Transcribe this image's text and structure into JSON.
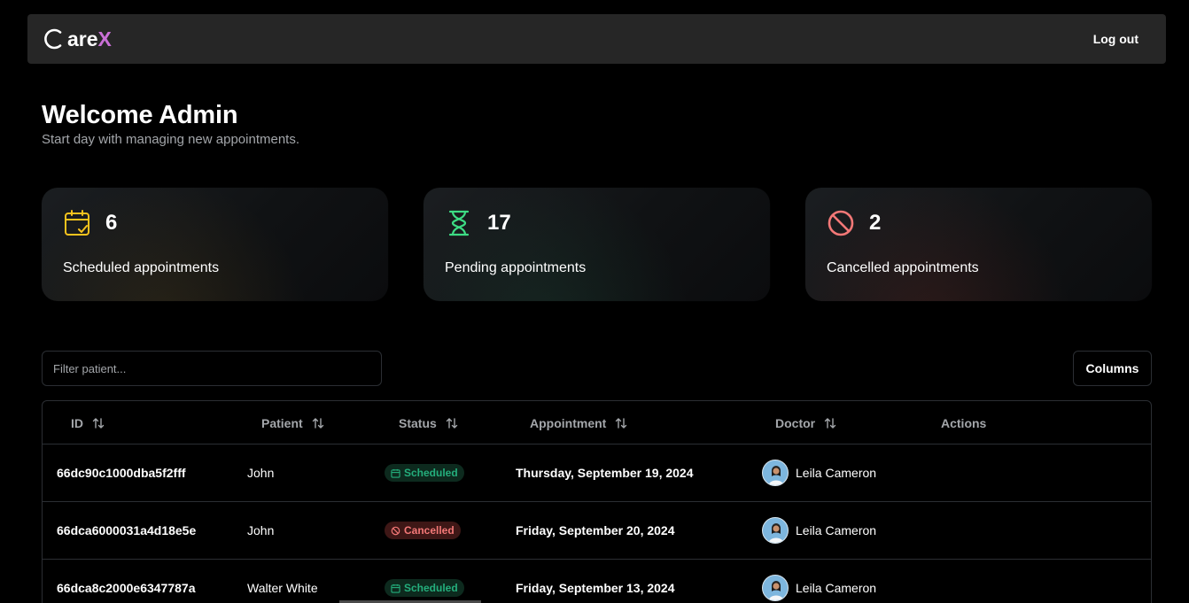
{
  "brand": {
    "mid": "are",
    "x": "X",
    "accent": "#c96fd6"
  },
  "nav": {
    "logout_label": "Log out"
  },
  "welcome": {
    "title": "Welcome Admin",
    "subtitle": "Start day with managing new appointments."
  },
  "stats": [
    {
      "icon": "calendar-check-icon",
      "count": "6",
      "label": "Scheduled appointments",
      "color": "#f9c31d"
    },
    {
      "icon": "hourglass-icon",
      "count": "17",
      "label": "Pending appointments",
      "color": "#3ddc84"
    },
    {
      "icon": "ban-icon",
      "count": "2",
      "label": "Cancelled appointments",
      "color": "#f37877"
    }
  ],
  "filter": {
    "placeholder": "Filter patient..."
  },
  "columns_label": "Columns",
  "table": {
    "headers": {
      "id": "ID",
      "patient": "Patient",
      "status": "Status",
      "appointment": "Appointment",
      "doctor": "Doctor",
      "actions": "Actions"
    },
    "rows": [
      {
        "id": "66dc90c1000dba5f2fff",
        "patient": "John",
        "status": "Scheduled",
        "date": "Thursday, September 19, 2024",
        "doctor": "Leila Cameron"
      },
      {
        "id": "66dca6000031a4d18e5e",
        "patient": "John",
        "status": "Cancelled",
        "date": "Friday, September 20, 2024",
        "doctor": "Leila Cameron"
      },
      {
        "id": "66dca8c2000e6347787a",
        "patient": "Walter White",
        "status": "Scheduled",
        "date": "Friday, September 13, 2024",
        "doctor": "Leila Cameron"
      }
    ]
  }
}
